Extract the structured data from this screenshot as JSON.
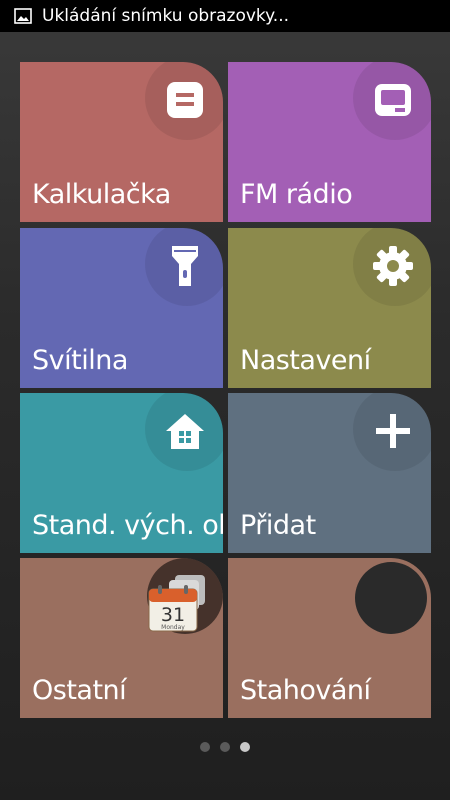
{
  "status_bar": {
    "notification_icon": "image-icon",
    "text": "Ukládání snímku obrazovky..."
  },
  "tiles": [
    {
      "label": "Kalkulačka",
      "color": "#b56864",
      "icon": "calculator-icon"
    },
    {
      "label": "FM rádio",
      "color": "#a35fb5",
      "icon": "radio-icon"
    },
    {
      "label": "Svítilna",
      "color": "#6368b3",
      "icon": "flashlight-icon"
    },
    {
      "label": "Nastavení",
      "color": "#8c8a4c",
      "icon": "gear-icon"
    },
    {
      "label": "Stand. vých. ob",
      "color": "#3a9aa4",
      "icon": "home-icon"
    },
    {
      "label": "Přidat",
      "color": "#5f7080",
      "icon": "plus-icon"
    },
    {
      "label": "Ostatní",
      "color": "#9a6f5f",
      "icon": "calendar-icon",
      "calendar_day": "31",
      "calendar_weekday": "Monday"
    },
    {
      "label": "Stahování",
      "color": "#9a6f5f",
      "icon": "download-icon"
    }
  ],
  "page_indicator": {
    "count": 3,
    "active_index": 2
  }
}
